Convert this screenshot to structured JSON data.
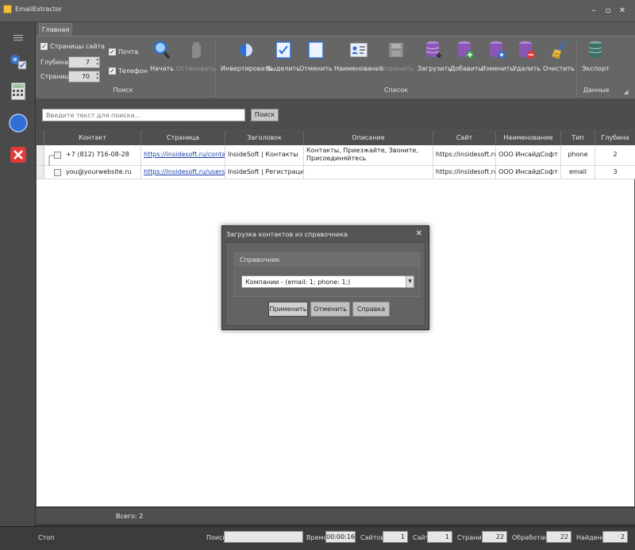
{
  "app": {
    "title": "EmailExtractor"
  },
  "ribbon": {
    "tab": "Главная",
    "search_group": {
      "label": "Поиск",
      "site_pages": "Страницы сайта",
      "depth_label": "Глубина:",
      "depth_value": "7",
      "pages_label": "Страниц:",
      "pages_value": "70",
      "mail": "Почта",
      "phone": "Телефон",
      "start": "Начать",
      "stop": "Остановить"
    },
    "list_group": {
      "label": "Список",
      "invert": "Инвертировать",
      "select": "Выделить",
      "cancel": "Отменить",
      "naming": "Наименование",
      "save": "Сохранить",
      "load": "Загрузить",
      "add": "Добавить",
      "edit": "Изменить",
      "delete": "Удалить",
      "clear": "Очистить"
    },
    "data_group": {
      "label": "Данные",
      "export": "Экспорт"
    }
  },
  "search": {
    "placeholder": "Введите текст для поиска...",
    "button": "Поиск"
  },
  "table": {
    "columns": [
      "Контакт",
      "Страница",
      "Заголовок",
      "Описание",
      "Сайт",
      "Наименование",
      "Тип",
      "Глубина"
    ],
    "rows": [
      {
        "contact": "+7 (812) 716-08-28",
        "page": "https://insidesoft.ru/contacts/",
        "header": "InsideSoft | Контакты",
        "description": "Контакты, Приезжайте, Звоните, Присоединяйтесь",
        "site": "https://insidesoft.ru/",
        "name": "ООО ИнсайдСофт",
        "type": "phone",
        "depth": "2"
      },
      {
        "contact": "you@yourwebsite.ru",
        "page": "https://insidesoft.ru/users/req...",
        "header": "InsideSoft | Регистрация",
        "description": "",
        "site": "https://insidesoft.ru/",
        "name": "ООО ИнсайдСофт",
        "type": "email",
        "depth": "3"
      }
    ],
    "total": "Всего: 2"
  },
  "dialog": {
    "title": "Загрузка контактов из справочника",
    "group_title": "Справочник",
    "selected": "Компании - (email: 1; phone: 1;)",
    "apply": "Применить",
    "cancel": "Отменить",
    "help": "Справка"
  },
  "status": {
    "state": "Стоп",
    "search_label": "Поиск",
    "time_label": "Время",
    "time_value": "00:00:16",
    "sites_label": "Сайтов",
    "sites_value": "1",
    "site_label": "Сайт",
    "site_value": "1",
    "pages_label": "Страниц",
    "pages_value": "22",
    "processed_label": "Обработано",
    "processed_value": "22",
    "found_label": "Найдено",
    "found_value": "2"
  },
  "colors": {
    "accent": "#2f6fd6",
    "close_red": "#e03a3a",
    "db_purple": "#8b56b5",
    "db_green": "#3c9a4e",
    "db_blue": "#3b6fc2"
  }
}
